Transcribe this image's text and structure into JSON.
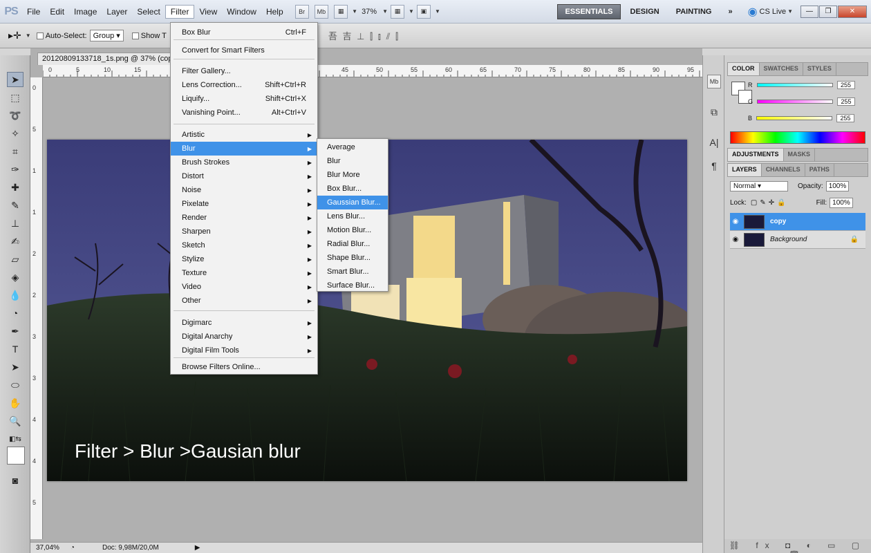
{
  "app": {
    "logo_text": "PS",
    "menu": [
      "File",
      "Edit",
      "Image",
      "Layer",
      "Select",
      "Filter",
      "View",
      "Window",
      "Help"
    ],
    "active_menu": "Filter",
    "br_label": "Br",
    "mb_label": "Mb",
    "zoom": "37%",
    "workspaces": [
      "ESSENTIALS",
      "DESIGN",
      "PAINTING"
    ],
    "more_workspaces": "»",
    "cs_live": "CS Live"
  },
  "options_bar": {
    "auto_select_label": "Auto-Select:",
    "auto_select_value": "Group",
    "show_transform_label": "Show T",
    "align_icons": "吾 吉 ⊥  ⫿ ⫾ ⫽  ⫿"
  },
  "document": {
    "tab_title": "20120809133718_1s.png @ 37% (copy, R",
    "overlay_text": "Filter > Blur >Gausian blur",
    "ruler_marks": [
      "0",
      "5",
      "10",
      "15",
      "45",
      "50",
      "55",
      "60",
      "65",
      "70",
      "75",
      "80",
      "85",
      "90",
      "95"
    ],
    "vruler_marks": [
      "0",
      "5",
      "1",
      "1",
      "2",
      "2",
      "3",
      "3",
      "4",
      "4",
      "5"
    ]
  },
  "status": {
    "zoom": "37,04%",
    "doc_info": "Doc: 9,98M/20,0M"
  },
  "filter_menu": {
    "items": [
      {
        "label": "Box Blur",
        "shortcut": "Ctrl+F"
      },
      {
        "label": "Convert for Smart Filters",
        "shortcut": ""
      },
      {
        "label": "Filter Gallery...",
        "shortcut": ""
      },
      {
        "label": "Lens Correction...",
        "shortcut": "Shift+Ctrl+R"
      },
      {
        "label": "Liquify...",
        "shortcut": "Shift+Ctrl+X"
      },
      {
        "label": "Vanishing Point...",
        "shortcut": "Alt+Ctrl+V"
      },
      {
        "label": "Artistic",
        "submenu": true
      },
      {
        "label": "Blur",
        "submenu": true,
        "highlighted": true
      },
      {
        "label": "Brush Strokes",
        "submenu": true
      },
      {
        "label": "Distort",
        "submenu": true
      },
      {
        "label": "Noise",
        "submenu": true
      },
      {
        "label": "Pixelate",
        "submenu": true
      },
      {
        "label": "Render",
        "submenu": true
      },
      {
        "label": "Sharpen",
        "submenu": true
      },
      {
        "label": "Sketch",
        "submenu": true
      },
      {
        "label": "Stylize",
        "submenu": true
      },
      {
        "label": "Texture",
        "submenu": true
      },
      {
        "label": "Video",
        "submenu": true
      },
      {
        "label": "Other",
        "submenu": true
      },
      {
        "label": "Digimarc",
        "submenu": true
      },
      {
        "label": "Digital Anarchy",
        "submenu": true
      },
      {
        "label": "Digital Film Tools",
        "submenu": true
      },
      {
        "label": "Browse Filters Online...",
        "shortcut": ""
      }
    ]
  },
  "blur_submenu": {
    "items": [
      "Average",
      "Blur",
      "Blur More",
      "Box Blur...",
      "Gaussian Blur...",
      "Lens Blur...",
      "Motion Blur...",
      "Radial Blur...",
      "Shape Blur...",
      "Smart Blur...",
      "Surface Blur..."
    ],
    "highlighted": "Gaussian Blur..."
  },
  "color_panel": {
    "tabs": [
      "COLOR",
      "SWATCHES",
      "STYLES"
    ],
    "r_label": "R",
    "g_label": "G",
    "b_label": "B",
    "r": "255",
    "g": "255",
    "b": "255"
  },
  "adjustments_panel": {
    "tabs": [
      "ADJUSTMENTS",
      "MASKS"
    ]
  },
  "layers_panel": {
    "tabs": [
      "LAYERS",
      "CHANNELS",
      "PATHS"
    ],
    "blend_mode": "Normal",
    "opacity_label": "Opacity:",
    "opacity": "100%",
    "lock_label": "Lock:",
    "fill_label": "Fill:",
    "fill": "100%",
    "layers": [
      {
        "name": "copy",
        "selected": true
      },
      {
        "name": "Background",
        "selected": false
      }
    ]
  },
  "colors": {
    "highlight": "#3f92e8",
    "sky": "#4a4c8a"
  }
}
